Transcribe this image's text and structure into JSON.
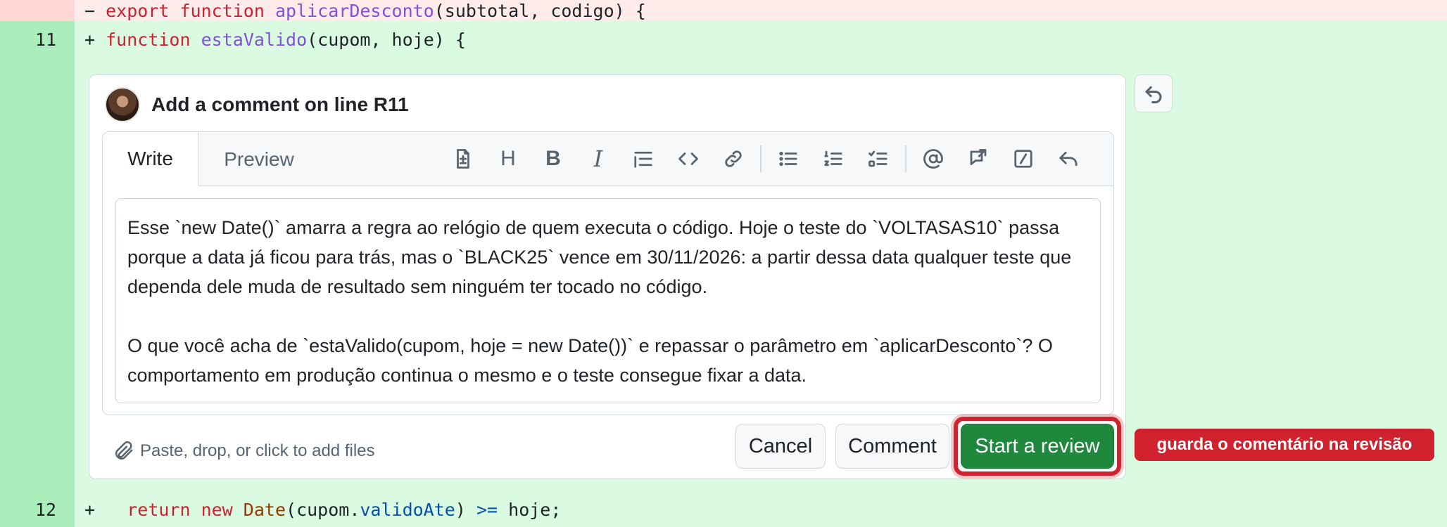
{
  "diff": {
    "deleted_line": {
      "sign": "−",
      "code": {
        "kw": "export function",
        "fn": "aplicarDesconto",
        "rest": "(subtotal, codigo) {"
      }
    },
    "line_11": {
      "number": "11",
      "sign": "+",
      "code": {
        "kw": "function",
        "fn": "estaValido",
        "rest": "(cupom, hoje) {"
      }
    },
    "line_12": {
      "number": "12",
      "sign": "+",
      "code": {
        "kw": "return new",
        "cls": "Date",
        "paren_open": "(cupom.",
        "prop": "validoAte",
        "paren_close": ")",
        "op": ">=",
        "rest": "hoje;"
      }
    }
  },
  "comment_box": {
    "title": "Add a comment on line R11",
    "tabs": {
      "write": "Write",
      "preview": "Preview"
    },
    "toolbar": {
      "heading": "H",
      "bold": "B",
      "italic": "I",
      "icons": [
        "file-icon",
        "heading-icon",
        "bold-icon",
        "italic-icon",
        "quote-icon",
        "code-icon",
        "link-icon",
        "bulleted-list-icon",
        "numbered-list-icon",
        "task-list-icon",
        "mention-icon",
        "cross-reference-icon",
        "slash-command-icon",
        "undo-icon"
      ]
    },
    "body": "Esse `new Date()` amarra a regra ao relógio de quem executa o código. Hoje o teste do `VOLTASAS10` passa porque a data já ficou para trás, mas o `BLACK25` vence em 30/11/2026: a partir dessa data qualquer teste que dependa dele muda de resultado sem ninguém ter tocado no código.\n\nO que você acha de `estaValido(cupom, hoje = new Date())` e repassar o parâmetro em `aplicarDesconto`? O comportamento em produção continua o mesmo e o teste consegue fixar a data.",
    "attach_text": "Paste, drop, or click to add files",
    "buttons": {
      "cancel": "Cancel",
      "comment": "Comment",
      "start_review": "Start a review"
    }
  },
  "annotation": "guarda o comentário na revisão",
  "colors": {
    "add_bg": "#dafbe1",
    "add_gutter": "#aceebb",
    "del_bg": "#ffebe9",
    "primary_green": "#1f883d",
    "highlight_red": "#cf222e"
  }
}
